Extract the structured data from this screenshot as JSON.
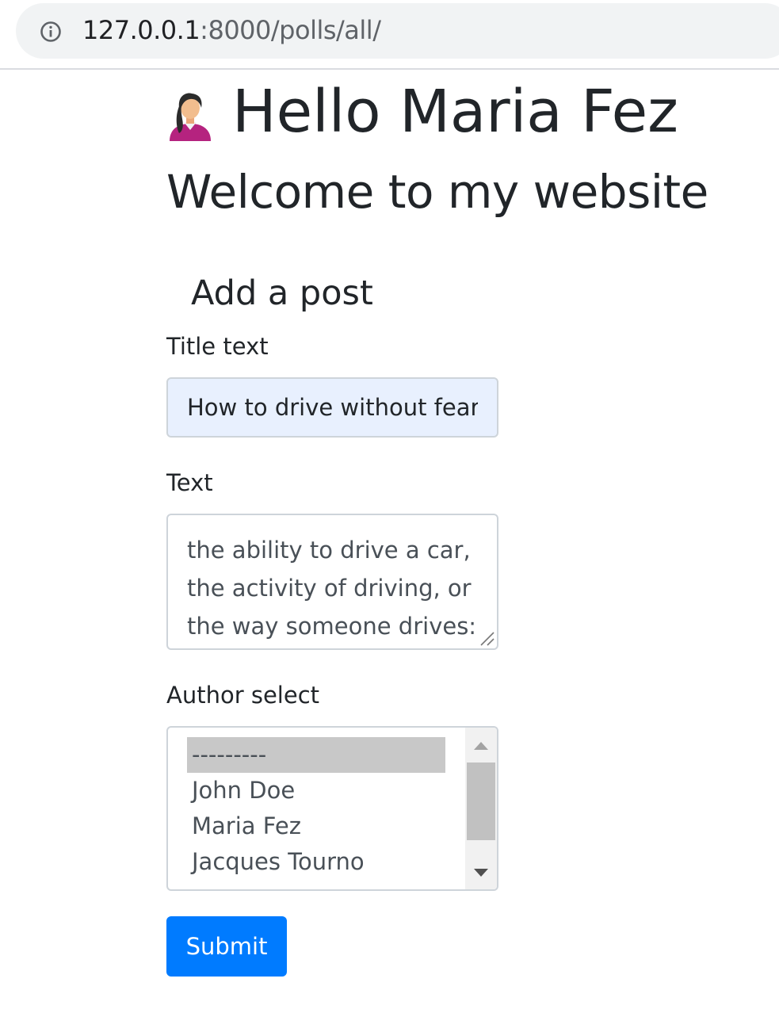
{
  "address_bar": {
    "icon": "info-icon",
    "host": "127.0.0.1",
    "path": ":8000/polls/all/"
  },
  "header": {
    "avatar_icon": "woman-avatar-icon",
    "greeting": "Hello Maria Fez",
    "welcome": "Welcome to my website"
  },
  "form": {
    "heading": "Add a post",
    "title_label": "Title text",
    "title_value": "How to drive without fear",
    "text_label": "Text",
    "text_lines": [
      "the ability to drive a car,",
      "the activity of driving, or",
      "the way someone drives:"
    ],
    "author_label": "Author select",
    "author_options": [
      "---------",
      "John Doe",
      "Maria Fez",
      "Jacques Tourno"
    ],
    "author_selected": "---------",
    "submit_label": "Submit"
  },
  "colors": {
    "primary": "#007bff",
    "autofill_bg": "#e8f0fe",
    "text": "#212529"
  }
}
